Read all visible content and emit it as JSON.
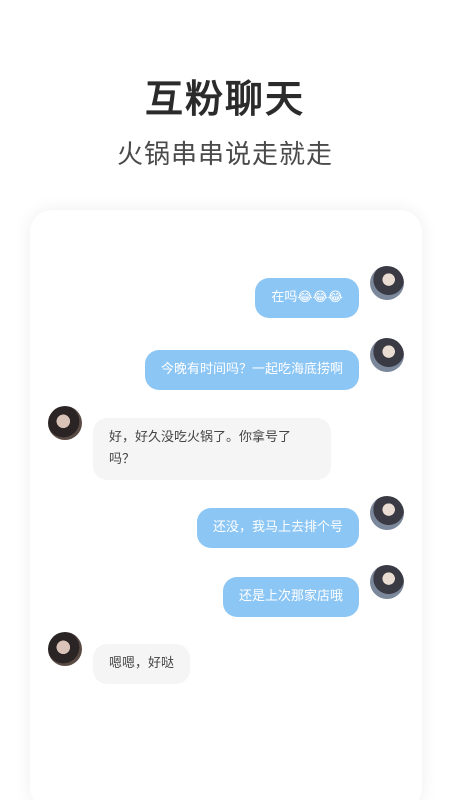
{
  "headline": "互粉聊天",
  "subline": "火锅串串说走就走",
  "messages": [
    {
      "side": "right",
      "text": "在吗😂😂😂"
    },
    {
      "side": "right",
      "text": "今晚有时间吗？一起吃海底捞啊"
    },
    {
      "side": "left",
      "text": "好，好久没吃火锅了。你拿号了吗？"
    },
    {
      "side": "right",
      "text": "还没，我马上去排个号"
    },
    {
      "side": "right",
      "text": "还是上次那家店哦"
    },
    {
      "side": "left",
      "text": "嗯嗯，好哒"
    }
  ],
  "colors": {
    "outgoing_bubble": "#8cc6f5",
    "incoming_bubble": "#f5f5f5",
    "headline": "#2b2b2b"
  }
}
